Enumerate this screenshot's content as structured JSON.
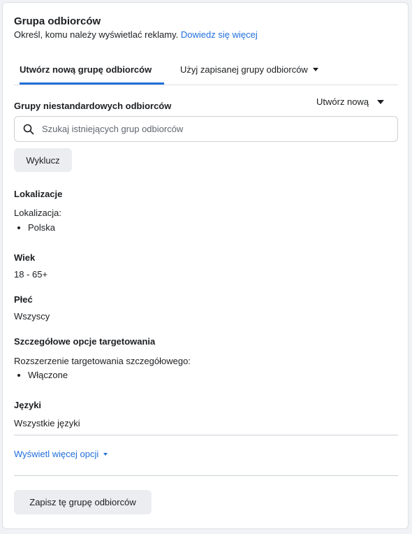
{
  "header": {
    "title": "Grupa odbiorców",
    "subtitle": "Określ, komu należy wyświetlać reklamy.",
    "learn_more": "Dowiedz się więcej"
  },
  "tabs": {
    "active": "Utwórz nową grupę odbiorców",
    "saved": "Użyj zapisanej grupy odbiorców"
  },
  "custom_audiences": {
    "label": "Grupy niestandardowych odbiorców",
    "create_new": "Utwórz nową",
    "search_placeholder": "Szukaj istniejących grup odbiorców",
    "exclude_button": "Wyklucz"
  },
  "locations": {
    "label": "Lokalizacje",
    "sublabel": "Lokalizacja:",
    "items": [
      "Polska"
    ]
  },
  "age": {
    "label": "Wiek",
    "value": "18 - 65+"
  },
  "gender": {
    "label": "Płeć",
    "value": "Wszyscy"
  },
  "detailed_targeting": {
    "label": "Szczegółowe opcje targetowania",
    "sublabel": "Rozszerzenie targetowania szczegółowego:",
    "items": [
      "Włączone"
    ]
  },
  "languages": {
    "label": "Języki",
    "value": "Wszystkie języki"
  },
  "show_more": "Wyświetl więcej opcji",
  "save_button": "Zapisz tę grupę odbiorców",
  "colors": {
    "accent": "#216fdb",
    "button_bg": "#ebedf0",
    "text": "#1c1e21",
    "border": "#ccd0d5"
  },
  "icons": {
    "search": "search-icon",
    "caret": "caret-down-icon"
  }
}
